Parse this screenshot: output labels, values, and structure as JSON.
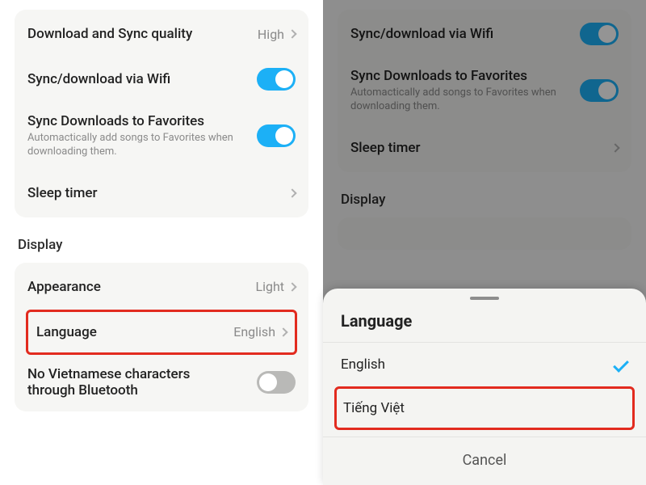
{
  "left": {
    "items": {
      "download_quality": {
        "title": "Download and Sync quality",
        "value": "High"
      },
      "wifi_sync": {
        "title": "Sync/download via Wifi"
      },
      "sync_favorites": {
        "title": "Sync Downloads to Favorites",
        "sub": "Automactically add songs to Favorites when downloading them."
      },
      "sleep_timer": {
        "title": "Sleep timer"
      }
    },
    "display_label": "Display",
    "display": {
      "appearance": {
        "title": "Appearance",
        "value": "Light"
      },
      "language": {
        "title": "Language",
        "value": "English"
      },
      "vn_chars": {
        "title": "No Vietnamese characters through Bluetooth"
      }
    }
  },
  "right": {
    "items": {
      "wifi_sync": {
        "title": "Sync/download via Wifi"
      },
      "sync_favorites": {
        "title": "Sync Downloads to Favorites",
        "sub": "Automactically add songs to Favorites when downloading them."
      },
      "sleep_timer": {
        "title": "Sleep timer"
      }
    },
    "display_label": "Display",
    "sheet": {
      "title": "Language",
      "option_en": "English",
      "option_vi": "Tiếng Việt",
      "cancel": "Cancel"
    }
  }
}
